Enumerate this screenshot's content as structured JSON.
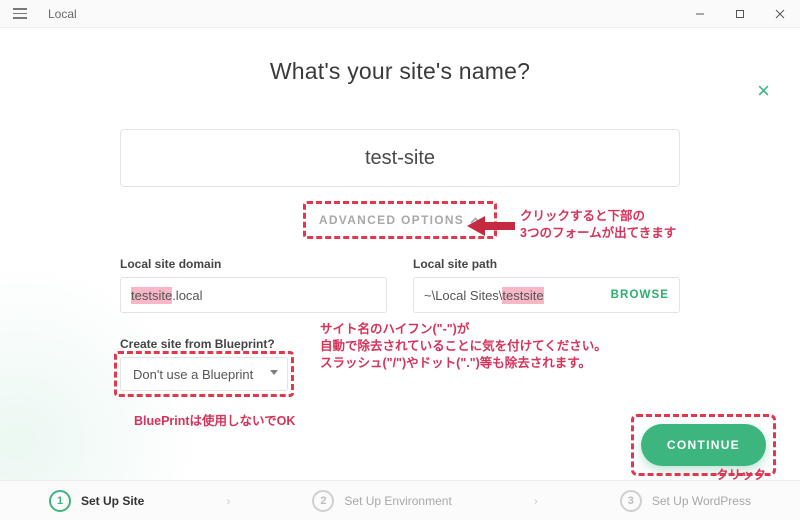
{
  "titlebar": {
    "app_name": "Local"
  },
  "modal": {
    "close_label": "×"
  },
  "heading": "What's your site's name?",
  "site_name_input": {
    "value": "test-site"
  },
  "advanced": {
    "label": "ADVANCED OPTIONS"
  },
  "annotations": {
    "adv_note_line1": "クリックすると下部の",
    "adv_note_line2": "3つのフォームが出てきます",
    "hyphen_note_line1": "サイト名のハイフン(\"-\")が",
    "hyphen_note_line2": "自動で除去されていることに気を付けてください。",
    "hyphen_note_line3": "スラッシュ(\"/\")やドット(\".\")等も除去されます。",
    "blueprint_note": "BluePrintは使用しないでOK",
    "continue_note": "クリック"
  },
  "fields": {
    "domain": {
      "label": "Local site domain",
      "value_hl": "testsite",
      "value_rest": ".local"
    },
    "path": {
      "label": "Local site path",
      "value_pre": "~\\Local Sites\\",
      "value_hl": "testsite",
      "browse_label": "BROWSE"
    }
  },
  "blueprint": {
    "label": "Create site from Blueprint?",
    "selected": "Don't use a Blueprint"
  },
  "continue": {
    "label": "CONTINUE"
  },
  "steps": {
    "items": [
      {
        "num": "1",
        "label": "Set Up Site",
        "active": true
      },
      {
        "num": "2",
        "label": "Set Up Environment",
        "active": false
      },
      {
        "num": "3",
        "label": "Set Up WordPress",
        "active": false
      }
    ],
    "sep": "›"
  },
  "colors": {
    "accent_green": "#3db57f",
    "annotation_red": "#d6335a",
    "highlight_pink": "#f7b7c7"
  }
}
